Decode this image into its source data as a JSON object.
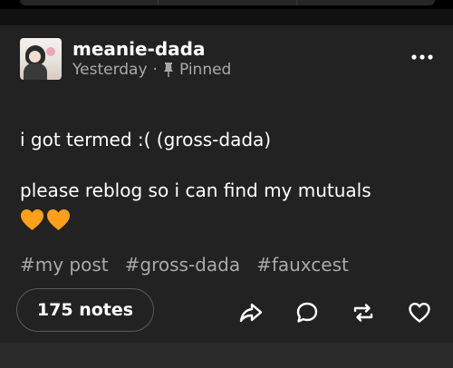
{
  "post": {
    "blog_name": "meanie-dada",
    "time": "Yesterday",
    "separator": "·",
    "pinned_label": "Pinned",
    "text_line_1": "i got termed :( (gross-dada)",
    "text_line_2": "please reblog so i can find my mutuals",
    "emoji": [
      "orange-heart",
      "orange-heart"
    ],
    "tags": [
      "#my post",
      "#gross-dada",
      "#fauxcest"
    ],
    "notes_label": "175 notes"
  },
  "colors": {
    "post_bg": "#222222",
    "secondary_text": "#a9a9a9",
    "heart_orange": "#ff9f1a"
  },
  "icons": {
    "more": "more-horizontal-icon",
    "pin": "pin-icon",
    "share": "share-icon",
    "reply": "reply-icon",
    "reblog": "reblog-icon",
    "like": "heart-outline-icon"
  }
}
